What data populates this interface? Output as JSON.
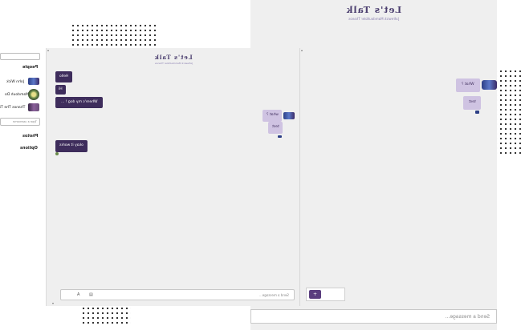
{
  "back_window": {
    "title": "Let's Talk",
    "subtitle": "Jafrewick Mamdouhbler Thanos",
    "input_placeholder": "Send a message...",
    "messages": [
      {
        "text": "What ?",
        "style": "light"
      },
      {
        "text": "test",
        "style": "light"
      }
    ],
    "panel_note": "hw !?"
  },
  "front_window": {
    "title": "Let's Talk",
    "subtitle": "Jafrewick Mamdouhbler Thanos",
    "input_placeholder": "Send a message...",
    "left_messages": [
      {
        "text": "Hello"
      },
      {
        "text": "Hi"
      },
      {
        "text": "Where's my dog ! ..."
      },
      {
        "text": "okay it works"
      }
    ],
    "right_messages": [
      {
        "text": "what ?"
      },
      {
        "text": "test"
      }
    ],
    "add_button_label": "+",
    "input_icons": {
      "emoji": "A",
      "attach": "▤"
    }
  },
  "sidebar": {
    "people_heading": "People",
    "users": [
      {
        "name": "John Wick",
        "avatar_color": "#3f5fb5"
      },
      {
        "name": "Mamdouh Do",
        "avatar_color": "#6a8a4a"
      },
      {
        "name": "Thanos The Ti",
        "avatar_color": "#6b4f7a"
      }
    ],
    "username_placeholder": "Type a username",
    "photos_label": "Photos",
    "options_label": "Options"
  },
  "colors": {
    "accent_dark": "#3e2d5c",
    "accent_light": "#cfc3e2",
    "title": "#4a3d6e"
  }
}
